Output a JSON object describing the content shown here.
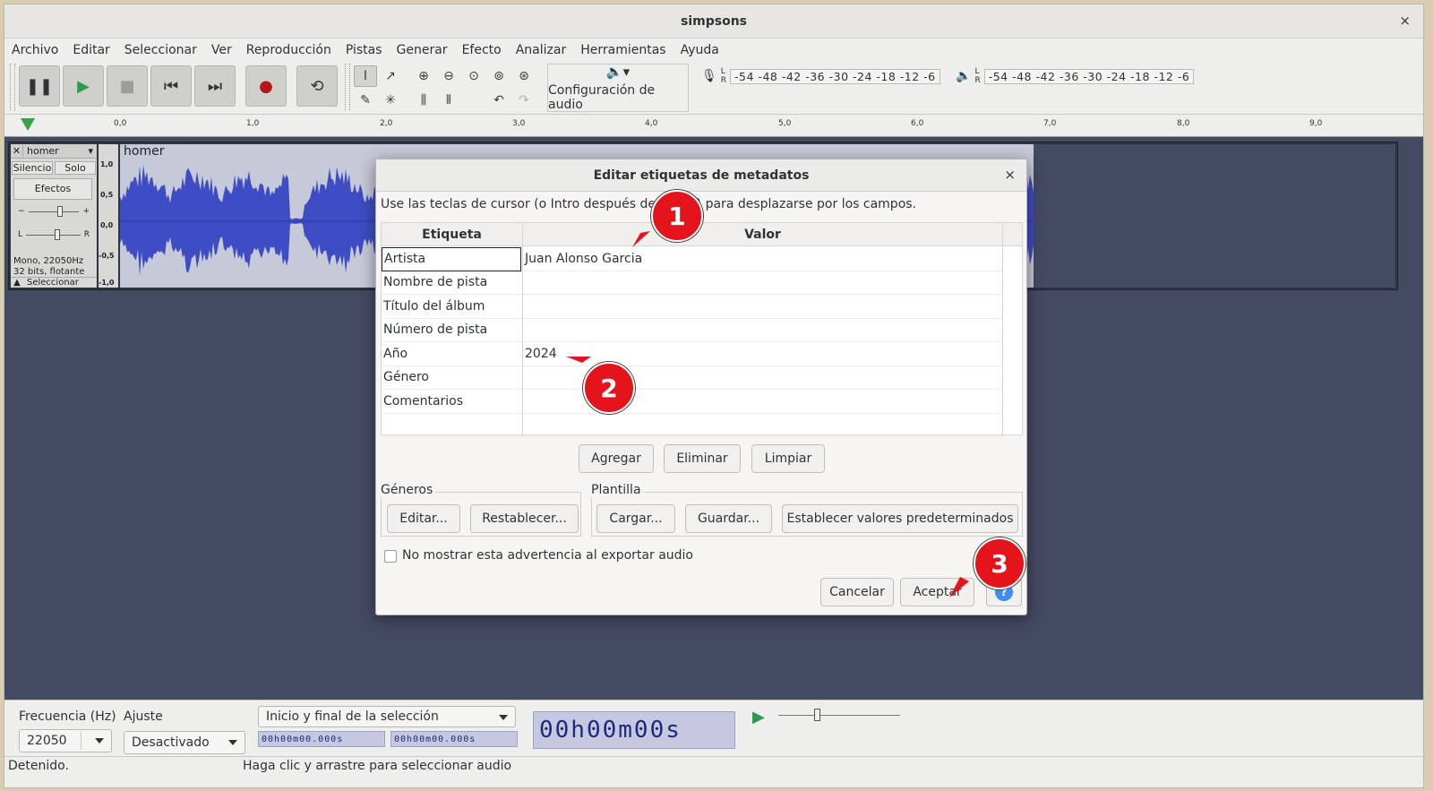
{
  "window": {
    "title": "simpsons",
    "close": "×"
  },
  "menu": [
    "Archivo",
    "Editar",
    "Seleccionar",
    "Ver",
    "Reproducción",
    "Pistas",
    "Generar",
    "Efecto",
    "Analizar",
    "Herramientas",
    "Ayuda"
  ],
  "toolbar": {
    "audio_setup_label": "Configuración de audio",
    "meter_record_scale": "-54 -48 -42 -36 -30 -24 -18 -12  -6",
    "meter_play_scale": "-54 -48 -42 -36 -30 -24 -18 -12  -6"
  },
  "ruler": [
    "0,0",
    "1,0",
    "2,0",
    "3,0",
    "4,0",
    "5,0",
    "6,0",
    "7,0",
    "8,0",
    "9,0"
  ],
  "track": {
    "name": "homer",
    "mute": "Silencio",
    "solo": "Solo",
    "effects": "Efectos",
    "info_line1": "Mono, 22050Hz",
    "info_line2": "32 bits, flotante",
    "select": "Seleccionar",
    "wave_label": "homer",
    "scale": [
      "1,0",
      "0,5",
      "0,0",
      "-0,5",
      "-1,0"
    ]
  },
  "dialog": {
    "title": "Editar etiquetas de metadatos",
    "hint": "Use las teclas de cursor (o Intro después de editar) para desplazarse por los campos.",
    "col_tag": "Etiqueta",
    "col_value": "Valor",
    "rows": [
      {
        "tag": "Artista",
        "value": "Juan Alonso Garcia"
      },
      {
        "tag": "Nombre de pista",
        "value": ""
      },
      {
        "tag": "Título del álbum",
        "value": ""
      },
      {
        "tag": "Número de pista",
        "value": ""
      },
      {
        "tag": "Año",
        "value": "2024"
      },
      {
        "tag": "Género",
        "value": ""
      },
      {
        "tag": "Comentarios",
        "value": ""
      },
      {
        "tag": "",
        "value": ""
      }
    ],
    "add": "Agregar",
    "remove": "Eliminar",
    "clear": "Limpiar",
    "genres_label": "Géneros",
    "genres_edit": "Editar...",
    "genres_reset": "Restablecer...",
    "template_label": "Plantilla",
    "template_load": "Cargar...",
    "template_save": "Guardar...",
    "template_defaults": "Establecer valores predeterminados",
    "dont_show": "No mostrar esta advertencia al exportar audio",
    "cancel": "Cancelar",
    "ok": "Aceptar",
    "help": "?"
  },
  "annotations": [
    "1",
    "2",
    "3"
  ],
  "bottom": {
    "rate_label": "Frecuencia (Hz)",
    "rate_value": "22050",
    "snap_label": "Ajuste",
    "snap_value": "Desactivado",
    "selection_mode": "Inicio y final de la selección",
    "sel_start": "00h00m00.000s",
    "sel_end": "00h00m00.000s",
    "big_time": "00h00m00s",
    "status_left": "Detenido.",
    "status_right": "Haga clic y arrastre para seleccionar audio"
  },
  "colors": {
    "annotation": "#e5141c",
    "waveform": "#3f4dc4",
    "help": "#3d8ef0"
  }
}
